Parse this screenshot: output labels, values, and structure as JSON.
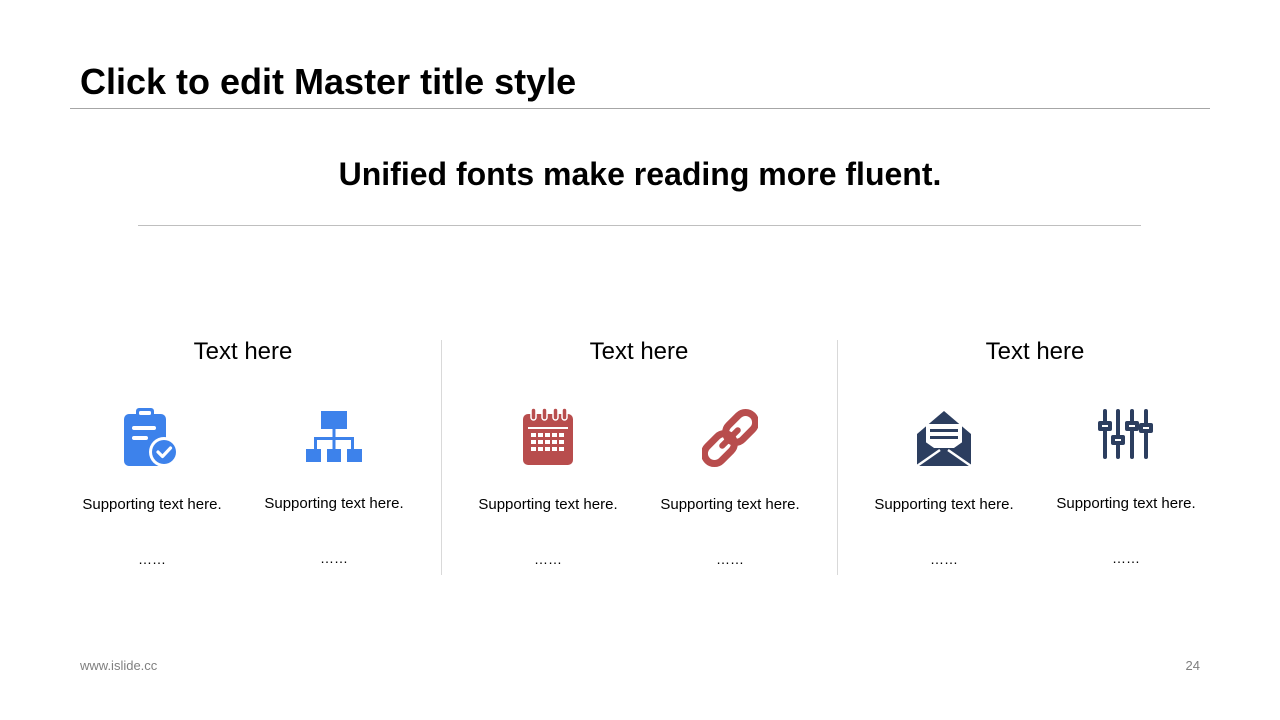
{
  "slide": {
    "title": "Click to edit Master title style",
    "subtitle": "Unified fonts make reading more fluent."
  },
  "colors": {
    "blue": "#3d82eb",
    "red": "#b84d4d",
    "navy": "#2c3e5f",
    "rule": "#a6a6a6"
  },
  "groups": [
    {
      "heading": "Text here",
      "items": [
        {
          "icon": "clipboard-check-icon",
          "text": "Supporting text here.",
          "dots": "……"
        },
        {
          "icon": "org-chart-icon",
          "text": "Supporting text here.",
          "dots": "……"
        }
      ]
    },
    {
      "heading": "Text here",
      "items": [
        {
          "icon": "calendar-icon",
          "text": "Supporting text here.",
          "dots": "……"
        },
        {
          "icon": "link-icon",
          "text": "Supporting text here.",
          "dots": "……"
        }
      ]
    },
    {
      "heading": "Text here",
      "items": [
        {
          "icon": "open-envelope-icon",
          "text": "Supporting text here.",
          "dots": "……"
        },
        {
          "icon": "sliders-icon",
          "text": "Supporting text here.",
          "dots": "……"
        }
      ]
    }
  ],
  "footer": {
    "url": "www.islide.cc",
    "page": "24"
  }
}
